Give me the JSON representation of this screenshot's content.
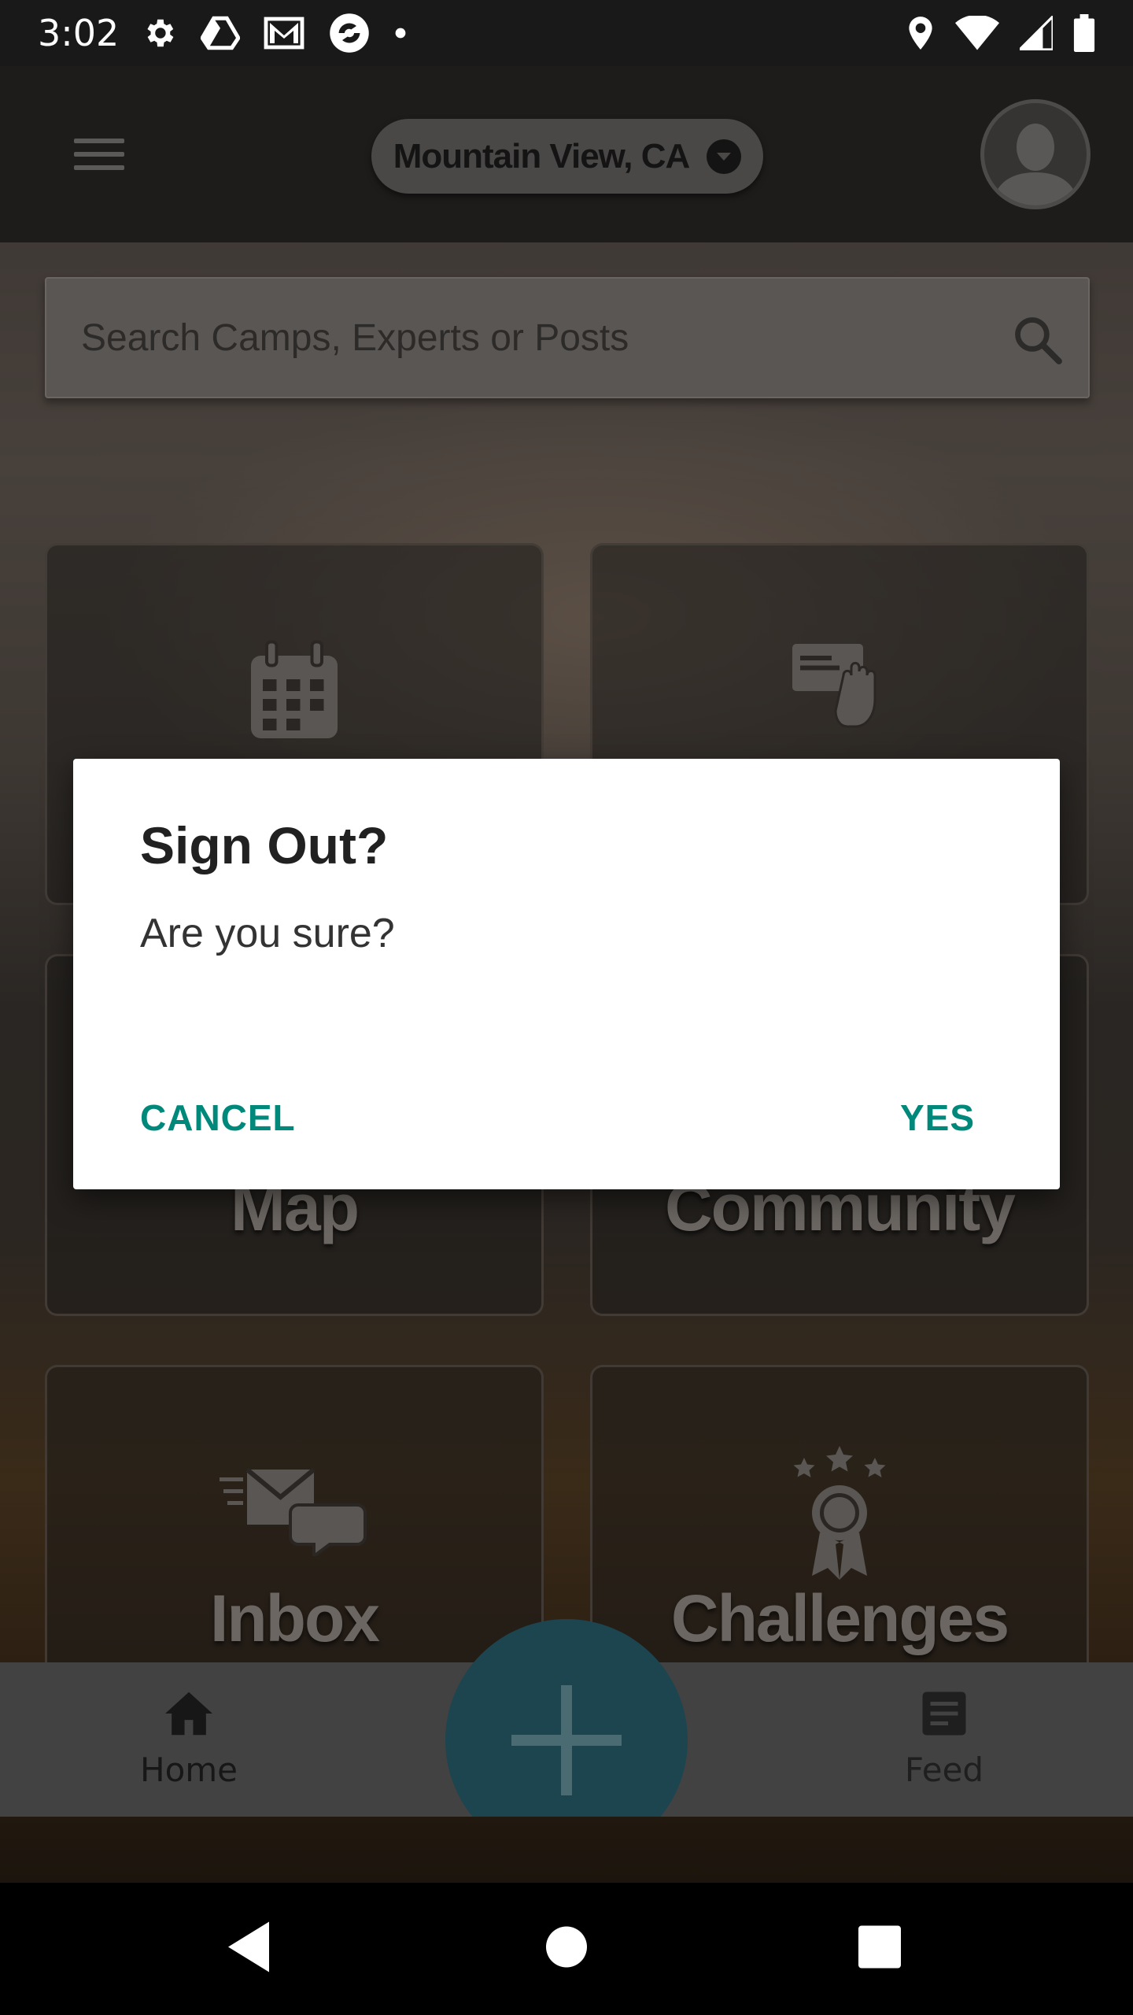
{
  "status_bar": {
    "time": "3:02",
    "left_icons": [
      "settings-icon",
      "drive-icon",
      "gmail-icon",
      "app-icon",
      "dot-icon"
    ],
    "right_icons": [
      "location-icon",
      "wifi-icon",
      "signal-icon",
      "battery-icon"
    ]
  },
  "header": {
    "menu_icon": "hamburger-menu-icon",
    "location": "Mountain View, CA",
    "location_caret_icon": "caret-down-icon",
    "avatar_icon": "profile-avatar-icon"
  },
  "search": {
    "placeholder": "Search Camps, Experts or Posts",
    "icon": "search-icon"
  },
  "tiles": [
    {
      "label": "",
      "icon": "calendar-icon"
    },
    {
      "label": "",
      "icon": "card-hand-icon"
    },
    {
      "label": "Map",
      "icon": ""
    },
    {
      "label": "Community",
      "icon": ""
    },
    {
      "label": "Inbox",
      "icon": "inbox-messages-icon"
    },
    {
      "label": "Challenges",
      "icon": "award-ribbon-icon"
    }
  ],
  "bottom_nav": {
    "home_label": "Home",
    "feed_label": "Feed",
    "fab_icon": "plus-icon"
  },
  "dialog": {
    "title": "Sign Out?",
    "message": "Are you sure?",
    "cancel_label": "CANCEL",
    "confirm_label": "YES",
    "button_color": "#00897b"
  },
  "android_nav": [
    "back-icon",
    "home-circle-icon",
    "recents-icon"
  ]
}
